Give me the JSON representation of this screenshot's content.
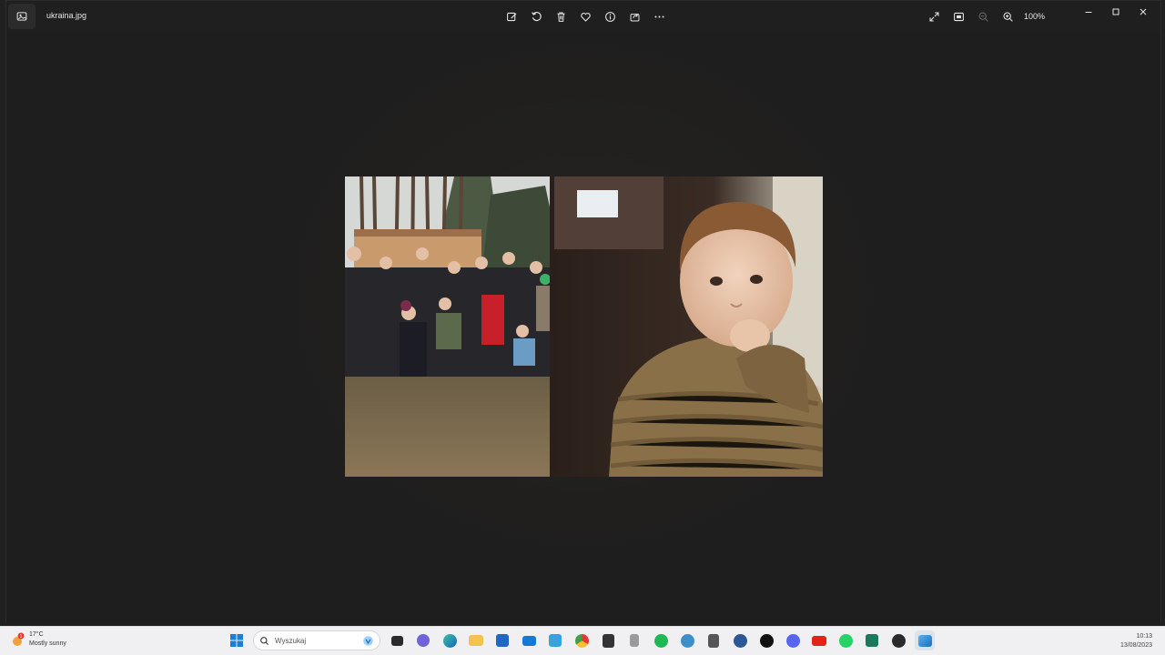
{
  "window": {
    "filename": "ukraina.jpg",
    "app_icon": "photos-app-icon",
    "toolbar": [
      {
        "name": "edit-image-button",
        "icon": "edit-icon"
      },
      {
        "name": "rotate-button",
        "icon": "rotate-icon"
      },
      {
        "name": "delete-button",
        "icon": "trash-icon"
      },
      {
        "name": "favorite-button",
        "icon": "heart-icon"
      },
      {
        "name": "info-button",
        "icon": "info-icon"
      },
      {
        "name": "share-button",
        "icon": "share-icon"
      },
      {
        "name": "more-button",
        "icon": "more-icon"
      }
    ],
    "right_toolbar": {
      "zoom_level": "100%"
    }
  },
  "weather": {
    "temperature": "17°C",
    "condition": "Mostly sunny",
    "badge": "1"
  },
  "taskbar": {
    "search_placeholder": "Wyszukaj"
  },
  "clock": {
    "time": "10:13",
    "date": "13/08/2023"
  },
  "colors": {
    "window_bg": "#1f1f1f",
    "taskbar_bg": "#f0f0f3",
    "accent": "#0067c0"
  }
}
